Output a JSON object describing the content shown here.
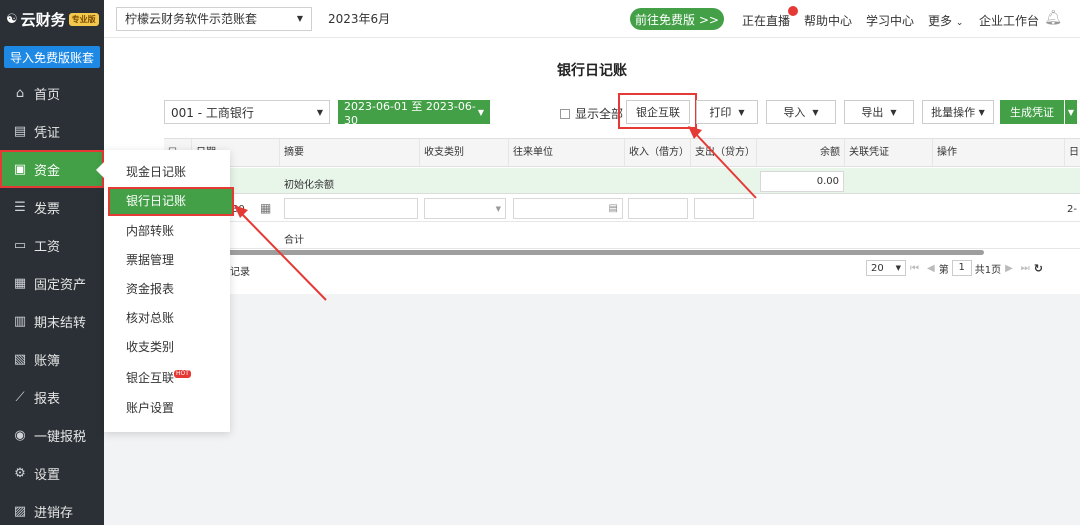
{
  "brand": {
    "name": "云财务",
    "badge": "专业版"
  },
  "sidebar": {
    "import_button": "导入免费版账套",
    "items": [
      {
        "label": "首页",
        "icon": "home-icon"
      },
      {
        "label": "凭证",
        "icon": "voucher-icon"
      },
      {
        "label": "资金",
        "icon": "funds-icon",
        "active": true
      },
      {
        "label": "发票",
        "icon": "invoice-icon"
      },
      {
        "label": "工资",
        "icon": "salary-icon"
      },
      {
        "label": "固定资产",
        "icon": "asset-icon"
      },
      {
        "label": "期末结转",
        "icon": "calendar-icon"
      },
      {
        "label": "账簿",
        "icon": "book-icon"
      },
      {
        "label": "报表",
        "icon": "chart-icon"
      },
      {
        "label": "一键报税",
        "icon": "tax-icon"
      },
      {
        "label": "设置",
        "icon": "gear-icon"
      },
      {
        "label": "进销存",
        "icon": "inventory-icon"
      }
    ]
  },
  "topbar": {
    "account": "柠檬云财务软件示范账套",
    "period": "2023年6月",
    "free_button": "前往免费版 >>",
    "live": "正在直播",
    "help": "帮助中心",
    "learn": "学习中心",
    "more": "更多",
    "workspace": "企业工作台"
  },
  "page": {
    "title": "银行日记账",
    "bank_account": "001 - 工商银行",
    "date_range": "2023-06-01 至 2023-06-30",
    "show_all": "显示全部",
    "bank_link": "银企互联",
    "print": "打印",
    "import": "导入",
    "export": "导出",
    "batch": "批量操作",
    "generate": "生成凭证"
  },
  "table": {
    "columns": [
      "日期",
      "摘要",
      "收支类别",
      "往来单位",
      "收入（借方）",
      "支出（贷方）",
      "余额",
      "关联凭证",
      "操作",
      "日"
    ],
    "init_summary": "初始化余额",
    "init_balance": "0.00",
    "edit_date_tail": "30",
    "edit_tail": "2-",
    "total_label": "合计",
    "record_text": "记录"
  },
  "pager": {
    "page_size": "20",
    "page_prefix": "第",
    "page_num": "1",
    "page_total": "共1页"
  },
  "submenu": {
    "items": [
      "现金日记账",
      "银行日记账",
      "内部转账",
      "票据管理",
      "资金报表",
      "核对总账",
      "收支类别",
      "银企互联",
      "账户设置"
    ],
    "hot_badge": "HOT"
  },
  "colors": {
    "green": "#43a047",
    "sidebar": "#2b3036",
    "red": "#e53935"
  }
}
